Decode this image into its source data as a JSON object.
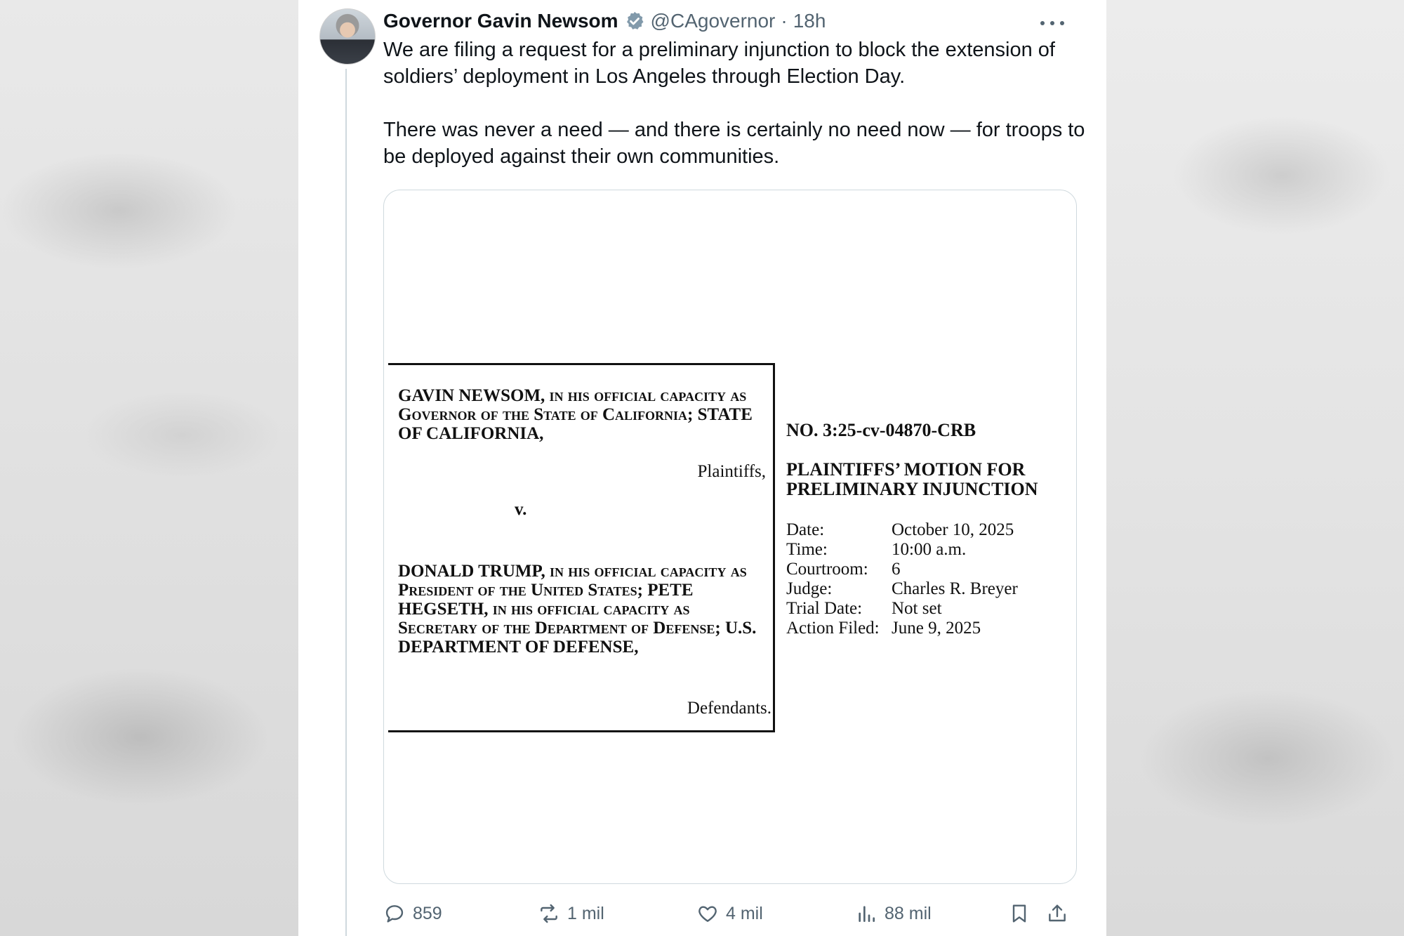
{
  "tweet": {
    "author": {
      "display_name": "Governor Gavin Newsom",
      "handle": "@CAgovernor",
      "separator": "·",
      "time": "18h",
      "verified_color": "#829aab"
    },
    "text_paragraphs": [
      "We are filing a request for a preliminary injunction to block the extension of soldiers’ deployment in Los Angeles through Election Day.",
      "There was never a need — and there is certainly no need now — for troops to be deployed against their own communities."
    ],
    "metrics": {
      "replies": "859",
      "reposts": "1 mil",
      "likes": "4 mil",
      "views": "88 mil"
    },
    "icons": {
      "reply": "reply-icon",
      "repost": "repost-icon",
      "like": "heart-icon",
      "views": "views-icon",
      "bookmark": "bookmark-icon",
      "share": "share-icon",
      "more": "more-icon",
      "verified": "verified-badge-icon"
    }
  },
  "document": {
    "plaintiffs": {
      "name_bold": "GAVIN NEWSOM,",
      "name_rest_1": " in his official capacity as Governor of the State of California; ",
      "name_bold_2": "STATE OF CALIFORNIA,",
      "label": "Plaintiffs,"
    },
    "versus": "v.",
    "defendants": {
      "part1_bold": "DONALD TRUMP,",
      "part2": " in his official capacity as President of the United States; ",
      "part3_bold": "PETE HEGSETH,",
      "part4": " in his official capacity as Secretary of the Department of Defense; ",
      "part5_bold": "U.S. DEPARTMENT OF DEFENSE,",
      "label": "Defendants."
    },
    "case_number": "NO. 3:25-cv-04870-CRB",
    "motion_title": "PLAINTIFFS’ MOTION FOR PRELIMINARY INJUNCTION",
    "details": [
      {
        "label": "Date:",
        "value": "October 10, 2025"
      },
      {
        "label": "Time:",
        "value": "10:00 a.m."
      },
      {
        "label": "Courtroom:",
        "value": "6"
      },
      {
        "label": "Judge:",
        "value": "Charles R. Breyer"
      },
      {
        "label": "Trial Date:",
        "value": "Not set"
      },
      {
        "label": "Action Filed:",
        "value": "June 9, 2025"
      }
    ]
  }
}
